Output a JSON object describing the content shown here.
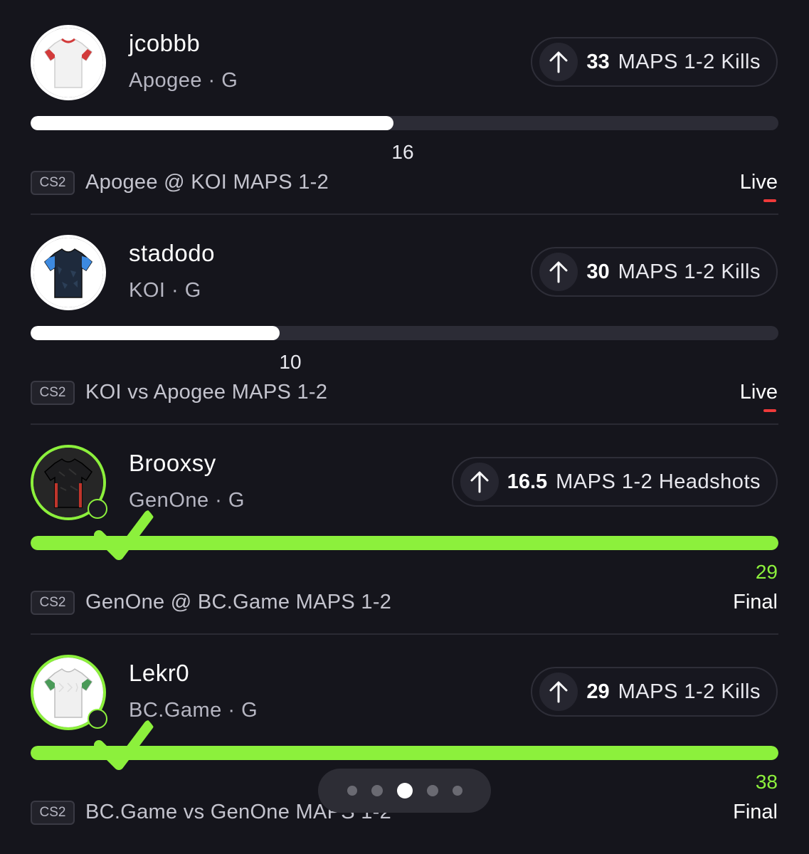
{
  "cards": [
    {
      "player": "jcobbb",
      "team_position": "Apogee · G",
      "line": "33",
      "stat": "MAPS 1-2 Kills",
      "direction_icon": "arrow-up-icon",
      "progress_value": "16",
      "progress_fraction": 0.485,
      "game_tag": "CS2",
      "matchup": "Apogee  @ KOI MAPS 1-2",
      "status": "Live",
      "won": false,
      "jersey_color": "#f2f2f2",
      "jersey_trim": "#d23b3b"
    },
    {
      "player": "stadodo",
      "team_position": "KOI · G",
      "line": "30",
      "stat": "MAPS 1-2 Kills",
      "direction_icon": "arrow-up-icon",
      "progress_value": "10",
      "progress_fraction": 0.333,
      "game_tag": "CS2",
      "matchup": "KOI  vs Apogee MAPS 1-2",
      "status": "Live",
      "won": false,
      "jersey_color": "#1e2a3c",
      "jersey_trim": "#3d8ae0"
    },
    {
      "player": "Brooxsy",
      "team_position": "GenOne · G",
      "line": "16.5",
      "stat": "MAPS 1-2 Headshots",
      "direction_icon": "arrow-up-icon",
      "progress_value": "29",
      "progress_fraction": 1.0,
      "game_tag": "CS2",
      "matchup": "GenOne  @ BC.Game MAPS 1-2",
      "status": "Final",
      "won": true,
      "jersey_color": "#1d1d1f",
      "jersey_trim": "#c0352b"
    },
    {
      "player": "Lekr0",
      "team_position": "BC.Game · G",
      "line": "29",
      "stat": "MAPS 1-2 Kills",
      "direction_icon": "arrow-up-icon",
      "progress_value": "38",
      "progress_fraction": 1.0,
      "game_tag": "CS2",
      "matchup": "BC.Game  vs GenOne MAPS 1-2",
      "status": "Final",
      "won": true,
      "jersey_color": "#f0f0f0",
      "jersey_trim": "#4a9a58"
    }
  ],
  "pager": {
    "count": 5,
    "active_index": 2
  },
  "colors": {
    "win": "#8cf03c",
    "live": "#ef3a3a",
    "background": "#15151c"
  }
}
